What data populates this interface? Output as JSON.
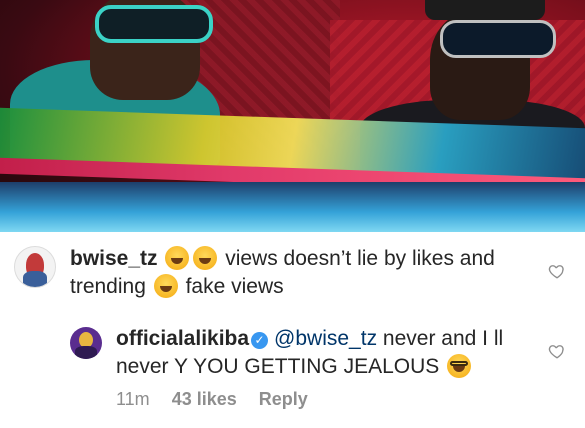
{
  "comments": [
    {
      "username": "bwise_tz",
      "text_part1": " views doesn’t lie by likes and trending ",
      "text_part2": " fake views",
      "emojis": [
        "grinning-sweat-emoji",
        "grinning-sweat-emoji",
        "tears-of-joy-emoji"
      ]
    },
    {
      "username": "officialalikiba",
      "verified": true,
      "mention": "@bwise_tz",
      "text": " never and I ll never Y YOU GETTING JEALOUS ",
      "emoji": "nerd-face-emoji",
      "time": "11m",
      "likes": "43 likes",
      "reply_label": "Reply"
    }
  ],
  "icons": {
    "like": "heart-outline-icon",
    "verified": "verified-badge-icon"
  },
  "colors": {
    "text": "#262626",
    "meta": "#8e8e8e",
    "mention": "#003569",
    "verified": "#3897f0"
  }
}
